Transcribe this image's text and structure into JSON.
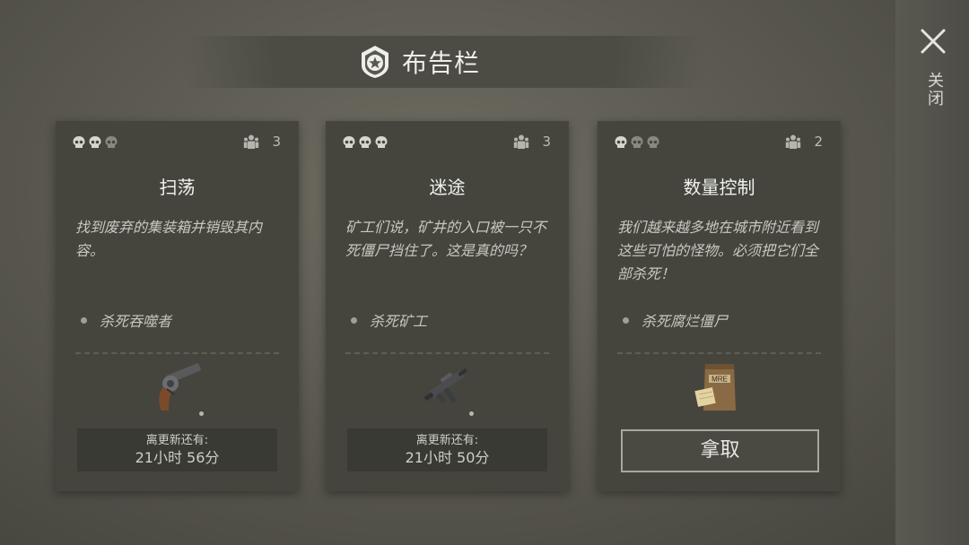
{
  "header": {
    "title": "布告栏",
    "close_label": "关闭"
  },
  "colors": {
    "card_bg": "#45453e",
    "skull_active": "#d6d5ce",
    "skull_inactive": "#8a897f"
  },
  "cards": [
    {
      "title": "扫荡",
      "description": "找到废弃的集装箱并销毁其内容。",
      "difficulty": 2,
      "players": "3",
      "objective": "杀死吞噬者",
      "reward_icon": "revolver-icon",
      "timer_label": "离更新还有:",
      "timer_value": "21小时 56分"
    },
    {
      "title": "迷途",
      "description": "矿工们说，矿井的入口被一只不死僵尸挡住了。这是真的吗？",
      "difficulty": 3,
      "players": "3",
      "objective": "杀死矿工",
      "reward_icon": "submachine-gun-icon",
      "timer_label": "离更新还有:",
      "timer_value": "21小时 50分"
    },
    {
      "title": "数量控制",
      "description": "我们越来越多地在城市附近看到这些可怕的怪物。必须把它们全部杀死！",
      "difficulty": 1,
      "players": "2",
      "objective": "杀死腐烂僵尸",
      "reward_icon": "mre-ration-icon",
      "reward_icon_text": "MRE",
      "claim_label": "拿取"
    }
  ]
}
